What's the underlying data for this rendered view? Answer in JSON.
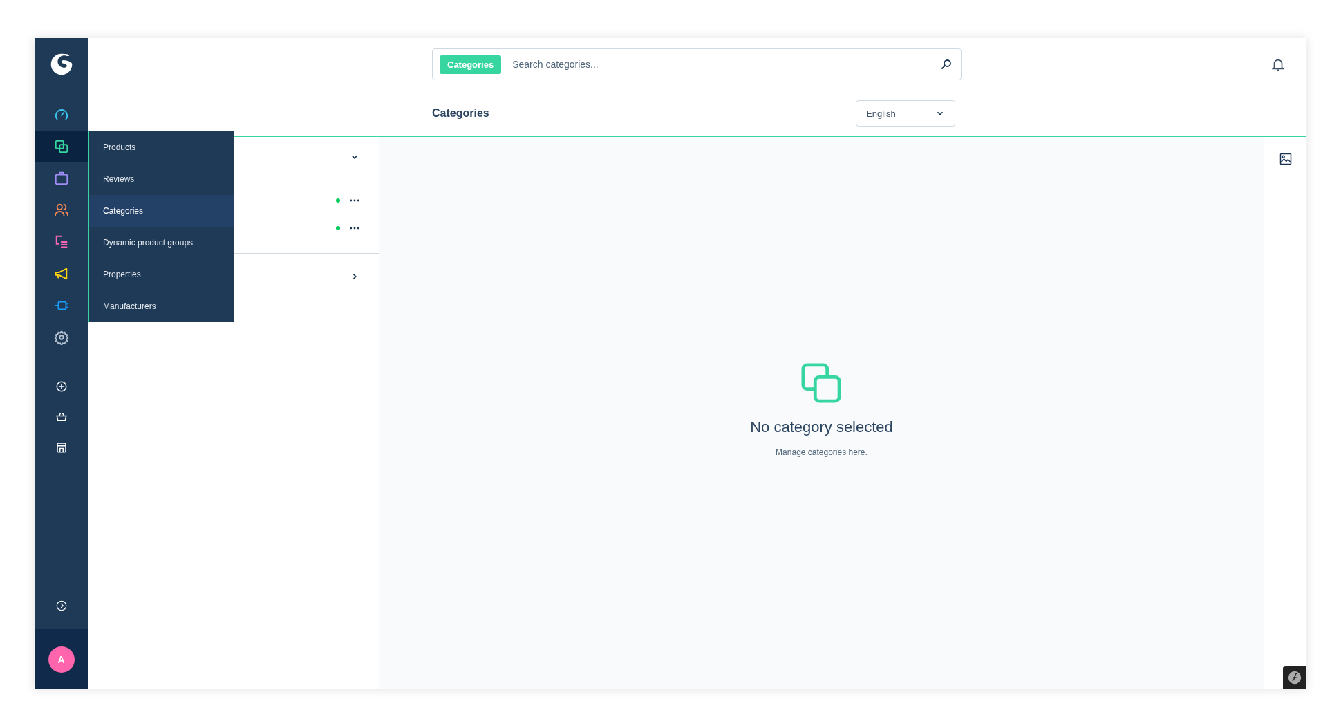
{
  "main_nav": [
    {
      "kind": "dashboard",
      "selected": false
    },
    {
      "kind": "catalog",
      "selected": true
    },
    {
      "kind": "orders",
      "selected": false
    },
    {
      "kind": "customers",
      "selected": false
    },
    {
      "kind": "content",
      "selected": false
    },
    {
      "kind": "marketing",
      "selected": false
    },
    {
      "kind": "extensions",
      "selected": false
    },
    {
      "kind": "settings",
      "selected": false
    }
  ],
  "quick_nav": [
    {
      "kind": "add"
    },
    {
      "kind": "basket"
    },
    {
      "kind": "store"
    }
  ],
  "user": {
    "initial": "A"
  },
  "flyout": [
    {
      "label": "Products",
      "selected": false
    },
    {
      "label": "Reviews",
      "selected": false
    },
    {
      "label": "Categories",
      "selected": true
    },
    {
      "label": "Dynamic product groups",
      "selected": false
    },
    {
      "label": "Properties",
      "selected": false
    },
    {
      "label": "Manufacturers",
      "selected": false
    }
  ],
  "search": {
    "tag": "Categories",
    "placeholder": "Search categories..."
  },
  "header": {
    "title": "Categories",
    "language": "English"
  },
  "tree": {
    "sections": [
      {
        "expanded": true,
        "items": [
          {
            "active": true
          },
          {
            "active": true
          }
        ]
      },
      {
        "expanded": false
      }
    ]
  },
  "empty_state": {
    "title": "No category selected",
    "text": "Manage categories here."
  }
}
